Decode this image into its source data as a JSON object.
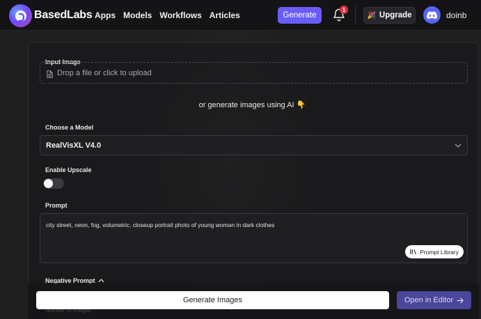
{
  "header": {
    "brand": "BasedLabs",
    "nav": [
      {
        "label": "Apps"
      },
      {
        "label": "Models"
      },
      {
        "label": "Workflows"
      },
      {
        "label": "Articles"
      }
    ],
    "generate_label": "Generate",
    "notification_count": "1",
    "upgrade_label": "Upgrade",
    "username": "doinb"
  },
  "form": {
    "input_image_label": "Input Image",
    "dropzone_text": "Drop a file or click to upload",
    "or_text": "or generate images using AI 👇",
    "model_label": "Choose a Model",
    "model_value": "RealVisXL V4.0",
    "upscale_label": "Enable Upscale",
    "upscale_enabled": false,
    "prompt_label": "Prompt",
    "prompt_value": "city street, neon, fog, volumetric, closeup portrait photo of young woman in dark clothes",
    "prompt_library_label": "Prompt Library",
    "negative_prompt_label": "Negative Prompt",
    "number_of_images_label": "Number of Images"
  },
  "actions": {
    "generate_images_label": "Generate Images",
    "open_editor_label": "Open in Editor"
  },
  "colors": {
    "accent": "#6a5cf6",
    "notification": "#e0313d",
    "discord": "#5865f2"
  }
}
